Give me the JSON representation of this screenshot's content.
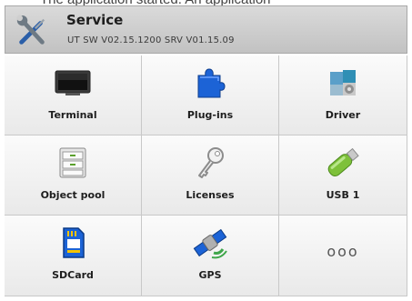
{
  "top_partial_text": "The application started. An application",
  "header": {
    "title": "Service",
    "subtitle": "UT SW V02.15.1200 SRV V01.15.09",
    "icon": "wrench-screwdriver-icon"
  },
  "tiles": [
    {
      "label": "Terminal",
      "icon": "terminal-screen-icon"
    },
    {
      "label": "Plug-ins",
      "icon": "puzzle-piece-icon"
    },
    {
      "label": "Driver",
      "icon": "puzzle-gear-icon"
    },
    {
      "label": "Object pool",
      "icon": "file-cabinet-icon"
    },
    {
      "label": "Licenses",
      "icon": "key-icon"
    },
    {
      "label": "USB 1",
      "icon": "usb-stick-icon"
    },
    {
      "label": "SDCard",
      "icon": "sd-card-icon"
    },
    {
      "label": "GPS",
      "icon": "satellite-icon"
    },
    {
      "label": "",
      "more_text": "ooo",
      "icon": "more-icon"
    }
  ],
  "colors": {
    "header_bg": "#cfcfcf",
    "tile_bg": "#f3f3f3",
    "accent_blue": "#1c63d6",
    "usb_green": "#7ec13a"
  }
}
